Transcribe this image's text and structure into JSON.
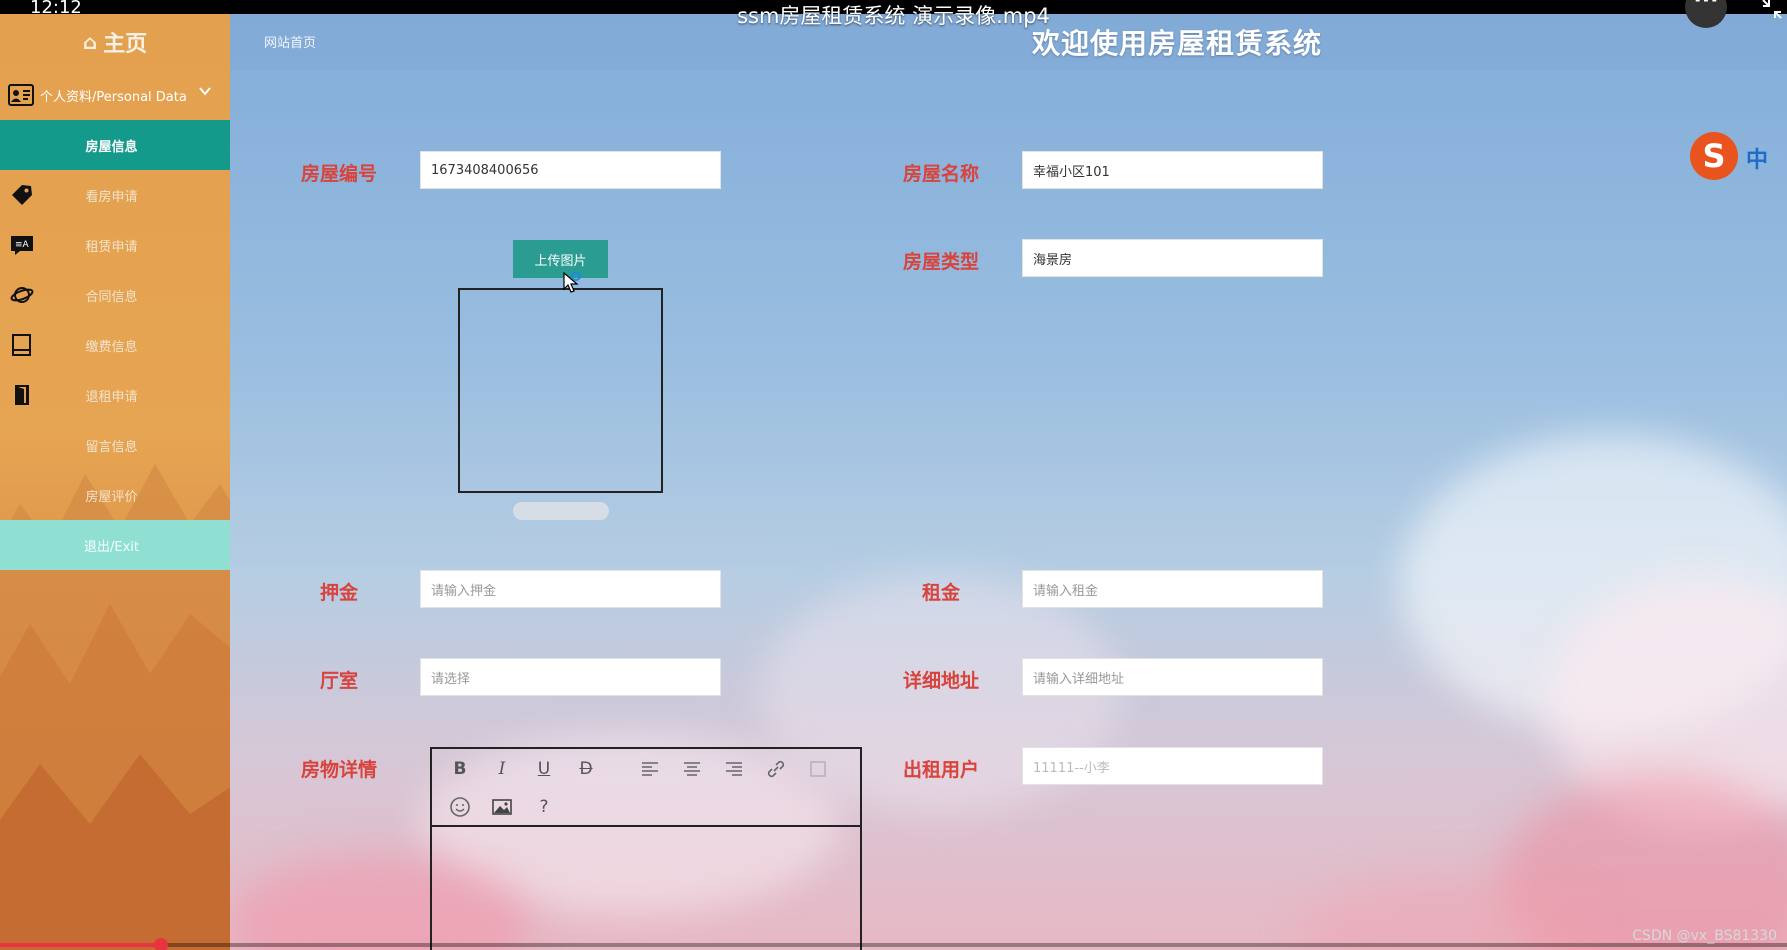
{
  "player": {
    "clock": "12:12",
    "video_title": "ssm房屋租赁系统 演示录像.mp4",
    "more_label": "···",
    "progress_fraction": 0.09,
    "watermark": "CSDN @vx_BS81330"
  },
  "sidebar": {
    "home_label": "主页",
    "profile_label": "个人资料/Personal Data",
    "items": [
      {
        "label": "房屋信息",
        "icon": "none"
      },
      {
        "label": "看房申请",
        "icon": "tag-icon"
      },
      {
        "label": "租赁申请",
        "icon": "translate-icon"
      },
      {
        "label": "合同信息",
        "icon": "planet-icon"
      },
      {
        "label": "缴费信息",
        "icon": "book-icon"
      },
      {
        "label": "退租申请",
        "icon": "door-icon"
      },
      {
        "label": "留言信息",
        "icon": "none"
      },
      {
        "label": "房屋评价",
        "icon": "none"
      }
    ],
    "exit_label": "退出/Exit"
  },
  "header": {
    "breadcrumb": "网站首页",
    "welcome": "欢迎使用房屋租赁系统"
  },
  "form": {
    "house_no": {
      "label": "房屋编号",
      "value": "1673408400656"
    },
    "house_name": {
      "label": "房屋名称",
      "value": "幸福小区101"
    },
    "house_type": {
      "label": "房屋类型",
      "value": "海景房"
    },
    "upload_label": "上传图片",
    "deposit": {
      "label": "押金",
      "placeholder": "请输入押金"
    },
    "rent": {
      "label": "租金",
      "placeholder": "请输入租金"
    },
    "rooms": {
      "label": "厅室",
      "placeholder": "请选择"
    },
    "address": {
      "label": "详细地址",
      "placeholder": "请输入详细地址"
    },
    "details": {
      "label": "房物详情"
    },
    "renter": {
      "label": "出租用户",
      "placeholder": "11111--小李"
    }
  },
  "editor_toolbar": [
    "B",
    "I",
    "U",
    "D",
    "align-left-icon",
    "align-center-icon",
    "align-right-icon",
    "link-icon",
    "grid-icon",
    "emoji-icon",
    "image-icon",
    "?"
  ],
  "ime": {
    "logo": "S",
    "mode": "中"
  },
  "colors": {
    "accent": "#149a8a",
    "label_red": "#d8433c",
    "sidebar_orange": "#e3a04e",
    "exit_teal": "#8fe0d2"
  }
}
